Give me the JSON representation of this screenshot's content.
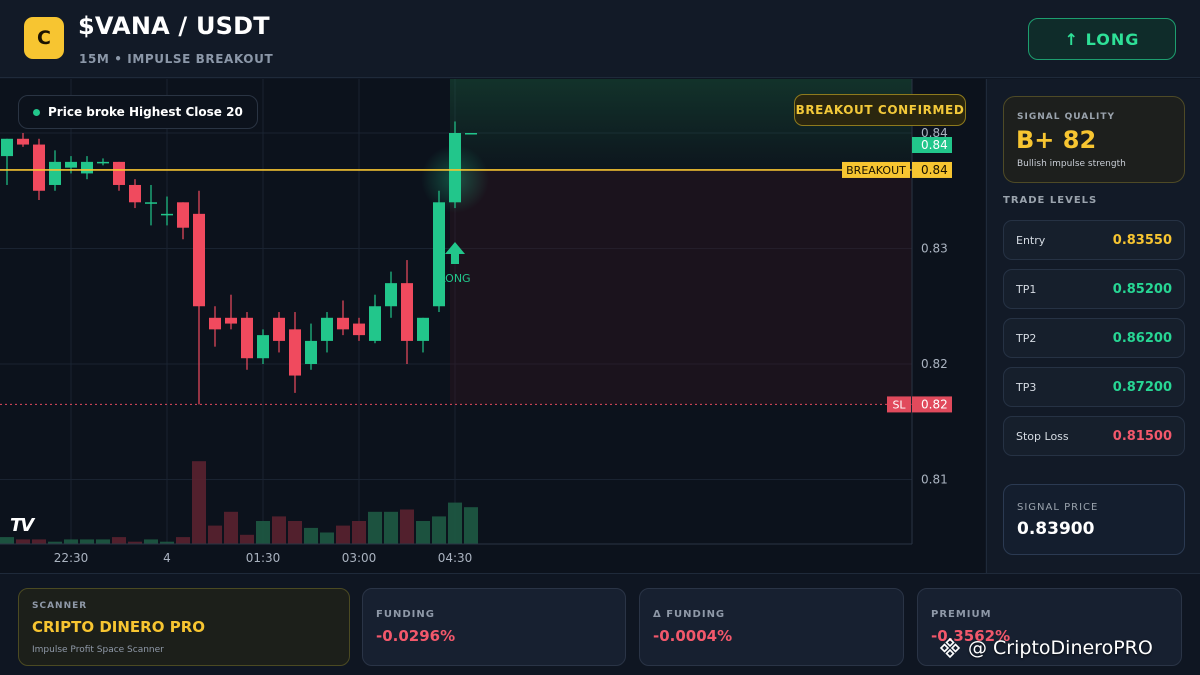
{
  "header": {
    "logo_letter": "C",
    "pair": "$VANA / USDT",
    "subtitle": "15M • IMPULSE BREAKOUT",
    "long_button": "↑ LONG"
  },
  "chart": {
    "note": "Price broke Highest Close 20",
    "confirmed_badge": "BREAKOUT CONFIRMED",
    "breakout_label": "BREAKOUT",
    "breakout_value": "0.84",
    "last_price_tag": "0.84",
    "sl_label": "SL",
    "sl_value": "0.82",
    "signal_label": "LONG",
    "tv_logo": "TV"
  },
  "chart_data": {
    "type": "candlestick",
    "y_ticks": [
      "0.84",
      "0.83",
      "0.82",
      "0.81"
    ],
    "x_ticks": [
      "22:30",
      "4",
      "01:30",
      "03:00",
      "04:30"
    ],
    "breakout_level": 0.8368,
    "stop_loss_level": 0.8165,
    "candles": [
      {
        "o": 0.838,
        "h": 0.8395,
        "l": 0.8355,
        "c": 0.8395
      },
      {
        "o": 0.8395,
        "h": 0.84,
        "l": 0.8388,
        "c": 0.839
      },
      {
        "o": 0.839,
        "h": 0.8395,
        "l": 0.8342,
        "c": 0.835
      },
      {
        "o": 0.8355,
        "h": 0.8385,
        "l": 0.835,
        "c": 0.8375
      },
      {
        "o": 0.837,
        "h": 0.838,
        "l": 0.8365,
        "c": 0.8375
      },
      {
        "o": 0.8365,
        "h": 0.838,
        "l": 0.836,
        "c": 0.8375
      },
      {
        "o": 0.8375,
        "h": 0.8378,
        "l": 0.8372,
        "c": 0.8375
      },
      {
        "o": 0.8375,
        "h": 0.8375,
        "l": 0.835,
        "c": 0.8355
      },
      {
        "o": 0.8355,
        "h": 0.836,
        "l": 0.8335,
        "c": 0.834
      },
      {
        "o": 0.834,
        "h": 0.8355,
        "l": 0.832,
        "c": 0.834
      },
      {
        "o": 0.833,
        "h": 0.8345,
        "l": 0.832,
        "c": 0.833
      },
      {
        "o": 0.834,
        "h": 0.834,
        "l": 0.8308,
        "c": 0.8318
      },
      {
        "o": 0.833,
        "h": 0.835,
        "l": 0.8165,
        "c": 0.825
      },
      {
        "o": 0.824,
        "h": 0.825,
        "l": 0.8215,
        "c": 0.823
      },
      {
        "o": 0.824,
        "h": 0.826,
        "l": 0.823,
        "c": 0.8235
      },
      {
        "o": 0.824,
        "h": 0.8245,
        "l": 0.8195,
        "c": 0.8205
      },
      {
        "o": 0.8205,
        "h": 0.823,
        "l": 0.82,
        "c": 0.8225
      },
      {
        "o": 0.824,
        "h": 0.8245,
        "l": 0.821,
        "c": 0.822
      },
      {
        "o": 0.823,
        "h": 0.8245,
        "l": 0.8175,
        "c": 0.819
      },
      {
        "o": 0.82,
        "h": 0.8235,
        "l": 0.8195,
        "c": 0.822
      },
      {
        "o": 0.822,
        "h": 0.8245,
        "l": 0.821,
        "c": 0.824
      },
      {
        "o": 0.824,
        "h": 0.8255,
        "l": 0.8225,
        "c": 0.823
      },
      {
        "o": 0.8235,
        "h": 0.824,
        "l": 0.822,
        "c": 0.8225
      },
      {
        "o": 0.822,
        "h": 0.826,
        "l": 0.8218,
        "c": 0.825
      },
      {
        "o": 0.825,
        "h": 0.828,
        "l": 0.824,
        "c": 0.827
      },
      {
        "o": 0.827,
        "h": 0.829,
        "l": 0.82,
        "c": 0.822
      },
      {
        "o": 0.822,
        "h": 0.824,
        "l": 0.821,
        "c": 0.824
      },
      {
        "o": 0.825,
        "h": 0.835,
        "l": 0.8245,
        "c": 0.834
      },
      {
        "o": 0.834,
        "h": 0.841,
        "l": 0.8335,
        "c": 0.84
      },
      {
        "o": 0.84,
        "h": 0.84,
        "l": 0.84,
        "c": 0.84
      }
    ],
    "volumes": [
      3,
      2,
      2,
      1,
      2,
      2,
      2,
      3,
      1,
      2,
      1,
      3,
      36,
      8,
      14,
      4,
      10,
      12,
      10,
      7,
      5,
      8,
      10,
      14,
      14,
      15,
      10,
      12,
      18,
      16
    ]
  },
  "side": {
    "quality_label": "SIGNAL QUALITY",
    "quality_grade": "B+ 82",
    "quality_desc": "Bullish impulse strength",
    "levels_title": "TRADE LEVELS",
    "levels": [
      {
        "name": "Entry",
        "value": "0.83550",
        "color": "#f7c531"
      },
      {
        "name": "TP1",
        "value": "0.85200",
        "color": "#27d694"
      },
      {
        "name": "TP2",
        "value": "0.86200",
        "color": "#27d694"
      },
      {
        "name": "TP3",
        "value": "0.87200",
        "color": "#27d694"
      },
      {
        "name": "Stop Loss",
        "value": "0.81500",
        "color": "#f2586b"
      }
    ],
    "signal_price_label": "SIGNAL PRICE",
    "signal_price": "0.83900"
  },
  "bottom": {
    "scanner_label": "SCANNER",
    "scanner_name": "CRIPTO DINERO PRO",
    "scanner_desc": "Impulse Profit Space Scanner",
    "funding_label": "FUNDING",
    "funding_value": "-0.0296%",
    "dfunding_label": "Δ FUNDING",
    "dfunding_value": "-0.0004%",
    "premium_label": "PREMIUM",
    "premium_value": "-0.3562%",
    "watermark": "@ CriptoDineroPRO"
  },
  "colors": {
    "bull": "#22c68b",
    "bear": "#f04a5e",
    "breakout": "#f7c531",
    "accent": "#f7c531"
  }
}
